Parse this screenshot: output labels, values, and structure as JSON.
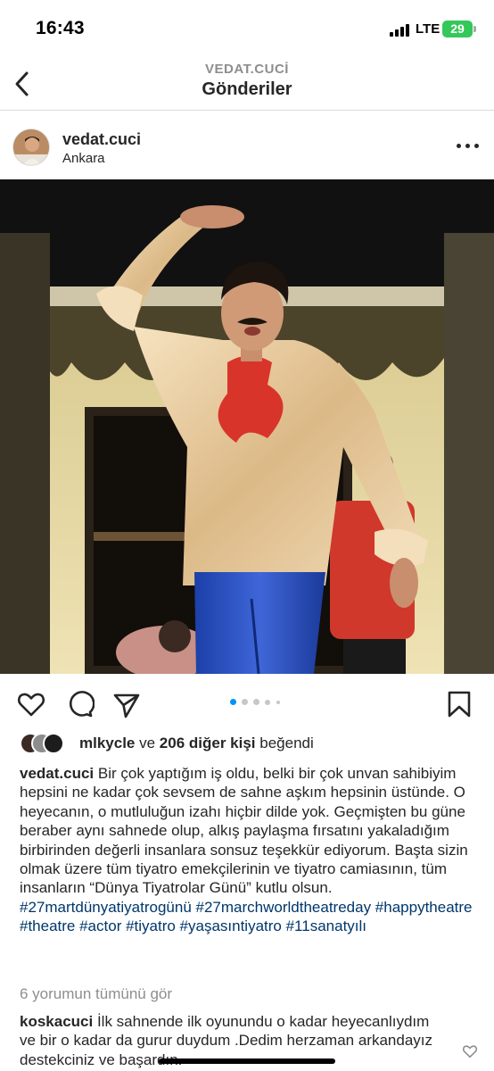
{
  "status_bar": {
    "time": "16:43",
    "network": "LTE",
    "battery": "29"
  },
  "nav": {
    "subtitle": "VEDAT.CUCİ",
    "title": "Gönderiler"
  },
  "post": {
    "username": "vedat.cuci",
    "location": "Ankara",
    "photo_subject": "stage actor in gold satin shirt, red cravat and blue trousers on theatre stage",
    "carousel": {
      "count": 5,
      "active_index": 0
    },
    "likes": {
      "first_user": "mlkycle",
      "connector": " ve ",
      "others": "206 diğer kişi",
      "suffix": " beğendi"
    },
    "caption": {
      "username": "vedat.cuci",
      "text": " Bir çok yaptığım iş oldu, belki bir çok unvan sahibiyim hepsini ne kadar çok sevsem de sahne aşkım hepsinin üstünde. O heyecanın, o mutluluğun izahı hiçbir dilde yok. Geçmişten bu güne beraber aynı sahnede olup, alkış paylaşma fırsatını yakaladığım birbirinden değerli insanlara sonsuz teşekkür ediyorum. Başta sizin olmak üzere tüm tiyatro emekçilerinin ve tiyatro camiasının, tüm insanların “Dünya Tiyatrolar Günü” kutlu olsun.",
      "hashtags": "#27martdünyatiyatrogünü #27marchworldtheatreday #happytheatre #theatre #actor #tiyatro #yaşasıntiyatro #11sanatyılı"
    },
    "view_comments": "6 yorumun tümünü gör",
    "comment": {
      "username": "koskacuci",
      "text": " İlk sahnende ilk oyunundu o kadar heyecanlıydım ve bir o kadar da gurur duydum .Dedim herzaman arkandayız destekciniz ve başardın."
    }
  },
  "icons": {
    "back": "chevron-left-icon",
    "more": "more-horizontal-icon",
    "like": "heart-icon",
    "comment": "comment-icon",
    "share": "paper-plane-icon",
    "save": "bookmark-icon"
  },
  "colors": {
    "text": "#262626",
    "muted": "#8e8e8e",
    "hashtag": "#00376b",
    "carousel_active": "#0095f6",
    "battery": "#34c759"
  }
}
